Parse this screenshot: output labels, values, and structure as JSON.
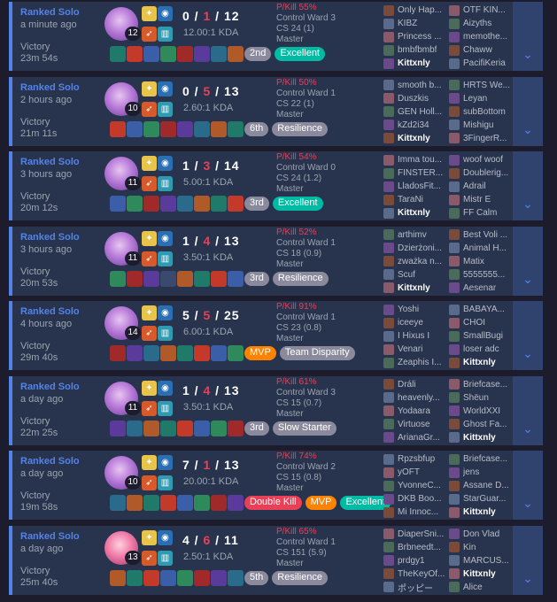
{
  "colors": {
    "accent": "#5383e8",
    "loss_red": "#e84057",
    "card_bg": "#28344e"
  },
  "matches": [
    {
      "mode": "Ranked Solo",
      "ago": "a minute ago",
      "result": "Victory",
      "duration": "23m 54s",
      "level": "12",
      "kda": {
        "k": "0",
        "d": "1",
        "a": "12"
      },
      "ratio": "12.00:1 KDA",
      "pkill": "P/Kill 55%",
      "ward": "Control Ward 3",
      "cs": "CS 24 (1)",
      "tier": "Master",
      "tags": [
        "2nd",
        "Excellent"
      ],
      "tag_kinds": [
        "pos",
        "green"
      ],
      "team_a": [
        "Only Hap...",
        "KIBZ",
        "Princess ...",
        "bmbfbmbf",
        "Kittxnly"
      ],
      "team_b": [
        "OTF KIN...",
        "Aizyths",
        "memothe...",
        "Chaww",
        "PacifiKeria"
      ],
      "me_team": "a",
      "alt": false
    },
    {
      "mode": "Ranked Solo",
      "ago": "2 hours ago",
      "result": "Victory",
      "duration": "21m 11s",
      "level": "10",
      "kda": {
        "k": "0",
        "d": "5",
        "a": "13"
      },
      "ratio": "2.60:1 KDA",
      "pkill": "P/Kill 50%",
      "ward": "Control Ward 1",
      "cs": "CS 22 (1)",
      "tier": "Master",
      "tags": [
        "6th",
        "Resilience"
      ],
      "tag_kinds": [
        "pos",
        "gray"
      ],
      "team_a": [
        "smooth b...",
        "Duszkis",
        "GEN Holl...",
        "kZd2i34",
        "Kittxnly"
      ],
      "team_b": [
        "HRTS We...",
        "Leyan",
        "subBottom",
        "Mishigu",
        "3FingerR..."
      ],
      "me_team": "a",
      "alt": false
    },
    {
      "mode": "Ranked Solo",
      "ago": "3 hours ago",
      "result": "Victory",
      "duration": "20m 12s",
      "level": "11",
      "kda": {
        "k": "1",
        "d": "3",
        "a": "14"
      },
      "ratio": "5.00:1 KDA",
      "pkill": "P/Kill 54%",
      "ward": "Control Ward 0",
      "cs": "CS 24 (1.2)",
      "tier": "Master",
      "tags": [
        "3rd",
        "Excellent"
      ],
      "tag_kinds": [
        "pos",
        "green"
      ],
      "team_a": [
        "Imma tou...",
        "FINSTER...",
        "LladosFit...",
        "TaraNi",
        "Kittxnly"
      ],
      "team_b": [
        "woof woof",
        "Doublerig...",
        "Adrail",
        "Mistr E",
        "FF Calm"
      ],
      "me_team": "a",
      "alt": false
    },
    {
      "mode": "Ranked Solo",
      "ago": "3 hours ago",
      "result": "Victory",
      "duration": "20m 53s",
      "level": "11",
      "kda": {
        "k": "1",
        "d": "4",
        "a": "13"
      },
      "ratio": "3.50:1 KDA",
      "pkill": "P/Kill 52%",
      "ward": "Control Ward 1",
      "cs": "CS 18 (0.9)",
      "tier": "Master",
      "tags": [
        "3rd",
        "Resilience"
      ],
      "tag_kinds": [
        "pos",
        "gray"
      ],
      "team_a": [
        "arthimv",
        "Dzierżoni...",
        "zważka n...",
        "Scuf",
        "Kittxnly"
      ],
      "team_b": [
        "Best Voli ...",
        "Animal H...",
        "Matix",
        "5555555...",
        "Aesenar"
      ],
      "me_team": "a",
      "alt": false,
      "empty_slot": 3
    },
    {
      "mode": "Ranked Solo",
      "ago": "4 hours ago",
      "result": "Victory",
      "duration": "29m 40s",
      "level": "14",
      "kda": {
        "k": "5",
        "d": "5",
        "a": "25"
      },
      "ratio": "6.00:1 KDA",
      "pkill": "P/Kill 91%",
      "ward": "Control Ward 1",
      "cs": "CS 23 (0.8)",
      "tier": "Master",
      "tags": [
        "MVP",
        "Team Disparity"
      ],
      "tag_kinds": [
        "orange",
        "gray"
      ],
      "team_a": [
        "Yoshi",
        "iceeye",
        "I Hixus I",
        "Venari",
        "Zeaphis I..."
      ],
      "team_b": [
        "BABAYA...",
        "CHOI",
        "SmallBugi",
        "loser adc",
        "Kittxnly"
      ],
      "me_team": "b",
      "alt": false
    },
    {
      "mode": "Ranked Solo",
      "ago": "a day ago",
      "result": "Victory",
      "duration": "22m 25s",
      "level": "11",
      "kda": {
        "k": "1",
        "d": "4",
        "a": "13"
      },
      "ratio": "3.50:1 KDA",
      "pkill": "P/Kill 61%",
      "ward": "Control Ward 3",
      "cs": "CS 15 (0.7)",
      "tier": "Master",
      "tags": [
        "3rd",
        "Slow Starter"
      ],
      "tag_kinds": [
        "pos",
        "gray"
      ],
      "team_a": [
        "Dráli",
        "heavenly...",
        "Yodaara",
        "Virtuose",
        "ArianaGr..."
      ],
      "team_b": [
        "Briefcase...",
        "Shëun",
        "WorldXXI",
        "Ghost Fa...",
        "Kittxnly"
      ],
      "me_team": "b",
      "alt": false
    },
    {
      "mode": "Ranked Solo",
      "ago": "a day ago",
      "result": "Victory",
      "duration": "19m 58s",
      "level": "10",
      "kda": {
        "k": "7",
        "d": "1",
        "a": "13"
      },
      "ratio": "20.00:1 KDA",
      "pkill": "P/Kill 74%",
      "ward": "Control Ward 2",
      "cs": "CS 15 (0.8)",
      "tier": "Master",
      "tags": [
        "Double Kill",
        "MVP",
        "Excellent"
      ],
      "tag_kinds": [
        "red",
        "orange",
        "green"
      ],
      "team_a": [
        "Rpzsbfup",
        "yOFT",
        "YvonneC...",
        "DKB Boo...",
        "Mi Innoc..."
      ],
      "team_b": [
        "Briefcase...",
        "jens",
        "Assane D...",
        "StarGuar...",
        "Kittxnly"
      ],
      "me_team": "b",
      "alt": false
    },
    {
      "mode": "Ranked Solo",
      "ago": "a day ago",
      "result": "Victory",
      "duration": "25m 40s",
      "level": "13",
      "kda": {
        "k": "4",
        "d": "6",
        "a": "11"
      },
      "ratio": "2.50:1 KDA",
      "pkill": "P/Kill 65%",
      "ward": "Control Ward 1",
      "cs": "CS 151 (5.9)",
      "tier": "Master",
      "tags": [
        "5th",
        "Resilience"
      ],
      "tag_kinds": [
        "pos",
        "gray"
      ],
      "team_a": [
        "DiaperSni...",
        "Brbneedt...",
        "prdgy1",
        "TheKeyOf...",
        "ポッピー"
      ],
      "team_b": [
        "Don Vlad",
        "Kin",
        "MARCUS...",
        "Kittxnly",
        "Alice"
      ],
      "me_team": "b",
      "alt": true
    }
  ]
}
